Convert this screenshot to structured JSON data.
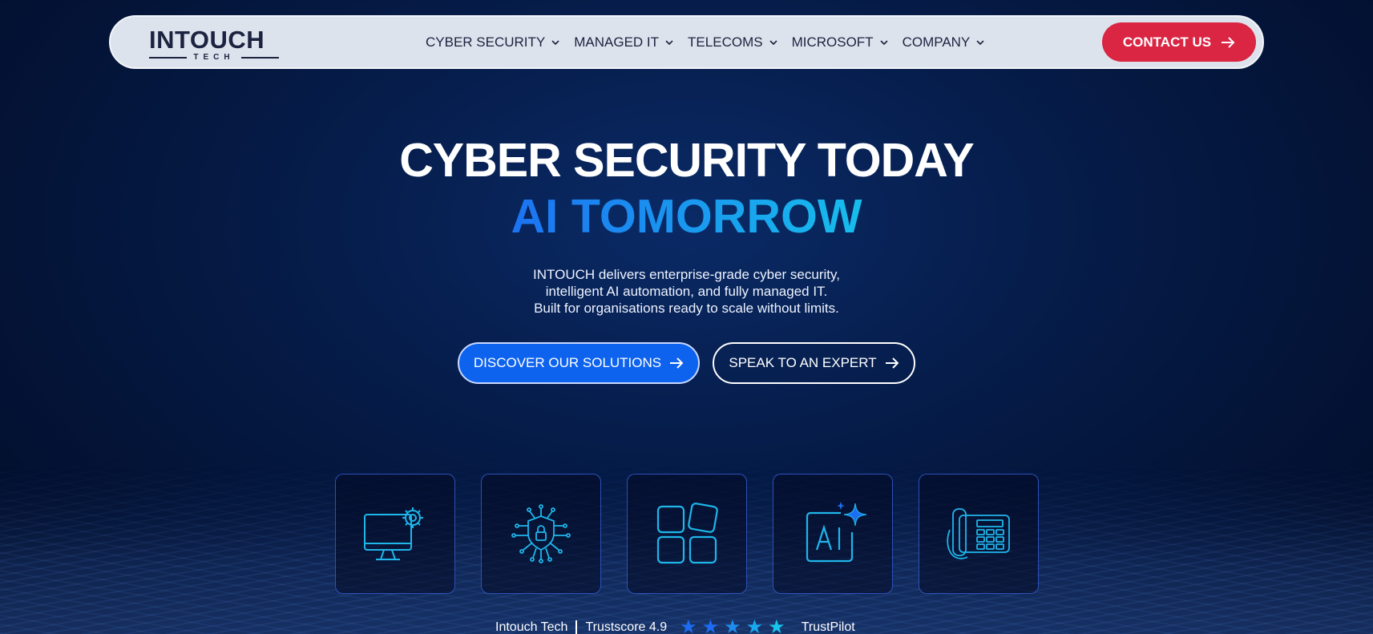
{
  "brand": {
    "name": "INTOUCH",
    "tagline": "TECH"
  },
  "nav": {
    "items": [
      {
        "label": "CYBER SECURITY"
      },
      {
        "label": "MANAGED IT"
      },
      {
        "label": "TELECOMS"
      },
      {
        "label": "MICROSOFT"
      },
      {
        "label": "COMPANY"
      }
    ],
    "contact_label": "CONTACT US"
  },
  "hero": {
    "title": "CYBER SECURITY TODAY",
    "subtitle": "AI TOMORROW",
    "description": [
      "INTOUCH delivers enterprise-grade cyber security,",
      "intelligent AI automation, and fully managed IT.",
      "Built for organisations ready to scale without limits."
    ],
    "primary_button": "DISCOVER OUR SOLUTIONS",
    "secondary_button": "SPEAK TO AN EXPERT"
  },
  "service_icons": [
    {
      "icon": "monitor-gear-icon"
    },
    {
      "icon": "shield-lock-circuit-icon"
    },
    {
      "icon": "apps-grid-icon"
    },
    {
      "icon": "ai-sparkle-icon"
    },
    {
      "icon": "desk-phone-icon"
    }
  ],
  "trust": {
    "company": "Intouch Tech",
    "score_text": "Trustscore 4.9",
    "star_count": 5,
    "provider": "TrustPilot"
  },
  "colors": {
    "accent_red": "#da2543",
    "accent_blue": "#0e63ee",
    "cyan": "#16c4ec",
    "nav_bg": "#dde3ec",
    "brand_dark": "#1b2340"
  }
}
